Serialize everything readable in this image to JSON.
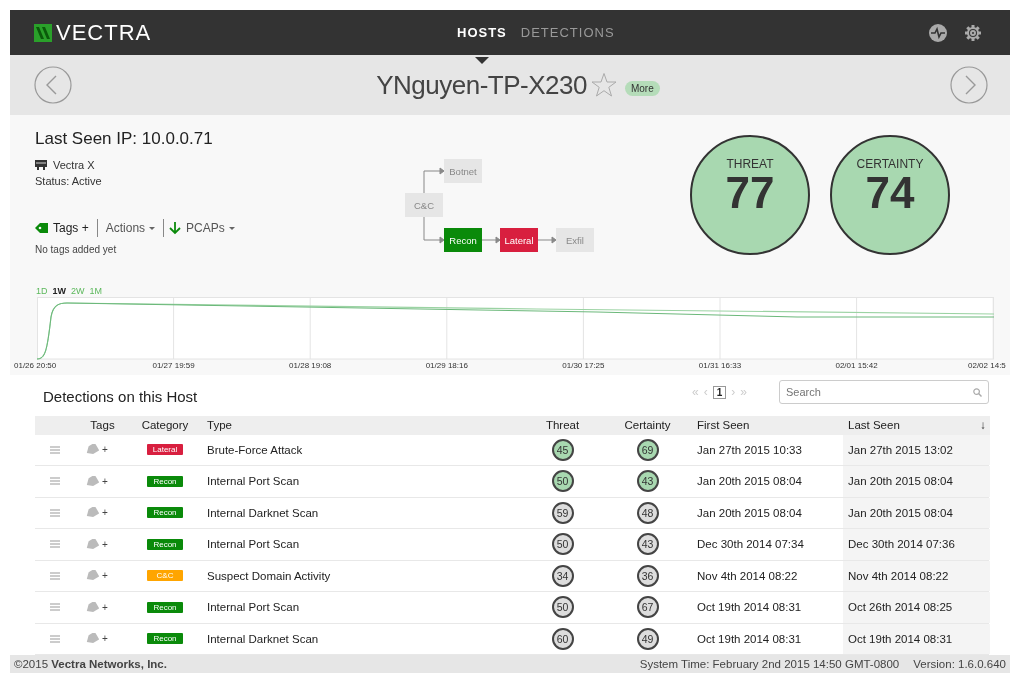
{
  "nav": {
    "logo": "VECTRA",
    "tabs": [
      {
        "label": "HOSTS",
        "selected": true
      },
      {
        "label": "DETECTIONS",
        "selected": false
      }
    ]
  },
  "host": {
    "name": "YNguyen-TP-X230",
    "starred": false,
    "more_button": "More"
  },
  "info": {
    "last_seen_ip": "Last Seen IP: 10.0.0.71",
    "sensor": "Vectra X",
    "status": "Status: Active",
    "tags_button": "Tags +",
    "actions_button": "Actions",
    "pcaps_button": "PCAPs",
    "tags_note": "No tags added yet"
  },
  "kill_chain": [
    {
      "label": "C&C",
      "color": "#e6e6e6"
    },
    {
      "label": "Botnet",
      "color": "#e6e6e6"
    },
    {
      "label": "Recon",
      "color": "#0a8a0a"
    },
    {
      "label": "Lateral",
      "color": "#d81f3f"
    },
    {
      "label": "Exfil",
      "color": "#e6e6e6"
    }
  ],
  "scores": [
    {
      "label": "THREAT",
      "value": "77"
    },
    {
      "label": "CERTAINTY",
      "value": "74"
    }
  ],
  "timeline": {
    "ranges": [
      {
        "label": "1D",
        "selected": false
      },
      {
        "label": "1W",
        "selected": true
      },
      {
        "label": "2W",
        "selected": false
      },
      {
        "label": "1M",
        "selected": false
      }
    ],
    "x_labels": [
      "01/26 20:50",
      "01/27 19:59",
      "01/28 19:08",
      "01/29 18:16",
      "01/30 17:25",
      "01/31 16:33",
      "02/01 15:42",
      "02/02 14:5"
    ]
  },
  "detections": {
    "title": "Detections on this Host",
    "pagination": {
      "first": "«",
      "prev": "‹",
      "pages": [
        {
          "label": "1",
          "selected": true
        }
      ],
      "next": "›",
      "last": "»"
    },
    "search": {
      "placeholder": "Search"
    },
    "columns": [
      {
        "label": "Tags"
      },
      {
        "label": "Category"
      },
      {
        "label": "Type"
      },
      {
        "label": "Threat"
      },
      {
        "label": "Certainty"
      },
      {
        "label": "First Seen"
      },
      {
        "label": "Last Seen",
        "sort_indicator": "↓"
      }
    ],
    "rows": [
      {
        "tags_add": "+",
        "category": {
          "label": "Lateral",
          "color": "#d81f3f"
        },
        "type": "Brute-Force Attack",
        "threat": {
          "value": "45",
          "color": "#a8d8b0"
        },
        "certainty": {
          "value": "69",
          "color": "#a8d8b0"
        },
        "first_seen": "Jan 27th 2015 10:33",
        "last_seen": "Jan 27th 2015 13:02"
      },
      {
        "tags_add": "+",
        "category": {
          "label": "Recon",
          "color": "#0a8a0a"
        },
        "type": "Internal Port Scan",
        "threat": {
          "value": "50",
          "color": "#a8d8b0"
        },
        "certainty": {
          "value": "43",
          "color": "#a8d8b0"
        },
        "first_seen": "Jan 20th 2015 08:04",
        "last_seen": "Jan 20th 2015 08:04"
      },
      {
        "tags_add": "+",
        "category": {
          "label": "Recon",
          "color": "#0a8a0a"
        },
        "type": "Internal Darknet Scan",
        "threat": {
          "value": "59",
          "color": "#dddddd"
        },
        "certainty": {
          "value": "48",
          "color": "#dddddd"
        },
        "first_seen": "Jan 20th 2015 08:04",
        "last_seen": "Jan 20th 2015 08:04"
      },
      {
        "tags_add": "+",
        "category": {
          "label": "Recon",
          "color": "#0a8a0a"
        },
        "type": "Internal Port Scan",
        "threat": {
          "value": "50",
          "color": "#dddddd"
        },
        "certainty": {
          "value": "43",
          "color": "#dddddd"
        },
        "first_seen": "Dec 30th 2014 07:34",
        "last_seen": "Dec 30th 2014 07:36"
      },
      {
        "tags_add": "+",
        "category": {
          "label": "C&C",
          "color": "#ffa500"
        },
        "type": "Suspect Domain Activity",
        "threat": {
          "value": "34",
          "color": "#dddddd"
        },
        "certainty": {
          "value": "36",
          "color": "#dddddd"
        },
        "first_seen": "Nov 4th 2014 08:22",
        "last_seen": "Nov 4th 2014 08:22"
      },
      {
        "tags_add": "+",
        "category": {
          "label": "Recon",
          "color": "#0a8a0a"
        },
        "type": "Internal Port Scan",
        "threat": {
          "value": "50",
          "color": "#dddddd"
        },
        "certainty": {
          "value": "67",
          "color": "#dddddd"
        },
        "first_seen": "Oct 19th 2014 08:31",
        "last_seen": "Oct 26th 2014 08:25"
      },
      {
        "tags_add": "+",
        "category": {
          "label": "Recon",
          "color": "#0a8a0a"
        },
        "type": "Internal Darknet Scan",
        "threat": {
          "value": "60",
          "color": "#dddddd"
        },
        "certainty": {
          "value": "49",
          "color": "#dddddd"
        },
        "first_seen": "Oct 19th 2014 08:31",
        "last_seen": "Oct 19th 2014 08:31"
      }
    ]
  },
  "footer": {
    "copyright": "©2015 **Vectra Networks, Inc.**",
    "system_time": "System Time: February 2nd 2015 14:50 GMT-0800",
    "version": "Version: 1.6.0.640"
  }
}
